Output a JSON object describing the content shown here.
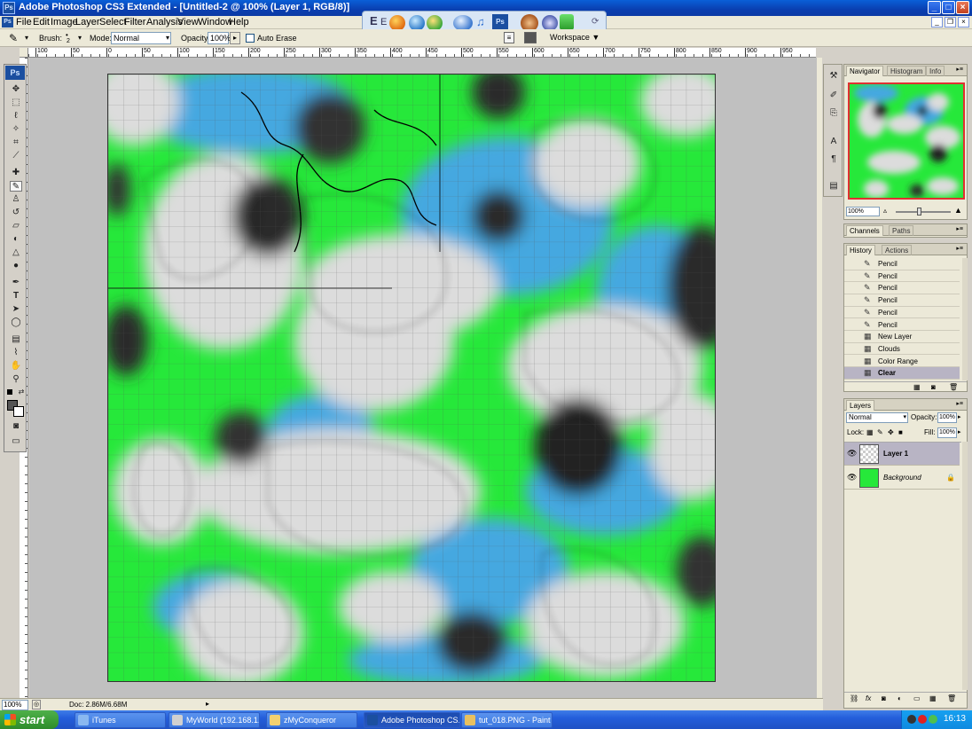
{
  "window": {
    "title": "Adobe Photoshop CS3 Extended - [Untitled-2 @ 100% (Layer 1, RGB/8)]"
  },
  "menus": [
    "File",
    "Edit",
    "Image",
    "Layer",
    "Select",
    "Filter",
    "Analysis",
    "View",
    "Window",
    "Help"
  ],
  "options": {
    "brush_label": "Brush:",
    "brush_size": "2",
    "mode_label": "Mode:",
    "mode_value": "Normal",
    "opacity_label": "Opacity:",
    "opacity_value": "100%",
    "auto_erase_label": "Auto Erase",
    "workspace_label": "Workspace ▼"
  },
  "ruler": {
    "ticks": [
      "100",
      "50",
      "0",
      "50",
      "100",
      "150",
      "200",
      "250",
      "300",
      "350",
      "400",
      "450",
      "500",
      "550",
      "600",
      "650",
      "700",
      "750",
      "800",
      "850",
      "900",
      "950"
    ]
  },
  "toolbox": {
    "logo": "Ps"
  },
  "status": {
    "zoom": "100%",
    "doc": "Doc: 2.86M/6.68M"
  },
  "panels": {
    "navigator": {
      "tabs": [
        "Navigator",
        "Histogram",
        "Info"
      ],
      "zoom": "100%"
    },
    "channels": {
      "tabs": [
        "Channels",
        "Paths"
      ]
    },
    "history": {
      "tabs": [
        "History",
        "Actions"
      ],
      "items": [
        {
          "label": "Pencil",
          "active": false
        },
        {
          "label": "Pencil",
          "active": false
        },
        {
          "label": "Pencil",
          "active": false
        },
        {
          "label": "Pencil",
          "active": false
        },
        {
          "label": "Pencil",
          "active": false
        },
        {
          "label": "Pencil",
          "active": false
        },
        {
          "label": "New Layer",
          "active": false
        },
        {
          "label": "Clouds",
          "active": false
        },
        {
          "label": "Color Range",
          "active": false
        },
        {
          "label": "Clear",
          "active": true
        }
      ]
    },
    "layers": {
      "tabs": [
        "Layers"
      ],
      "blend_mode": "Normal",
      "opacity_label": "Opacity:",
      "opacity_value": "100%",
      "lock_label": "Lock:",
      "fill_label": "Fill:",
      "fill_value": "100%",
      "items": [
        {
          "name": "Layer 1",
          "active": true
        },
        {
          "name": "Background",
          "active": false
        }
      ]
    }
  },
  "taskbar": {
    "start_label": "start",
    "tasks": [
      {
        "label": "iTunes",
        "active": false
      },
      {
        "label": "MyWorld (192.168.1....",
        "active": false
      },
      {
        "label": "zMyConqueror",
        "active": false
      },
      {
        "label": "Adobe Photoshop CS...",
        "active": true
      },
      {
        "label": "tut_018.PNG - Paint",
        "active": false
      }
    ],
    "clock": "16:13"
  },
  "colors": {
    "grass": "#26e83a",
    "water": "#45a8e0",
    "cloud": "#dcdcdc",
    "dark": "#2a2a2a",
    "xp_blue": "#245edb"
  }
}
